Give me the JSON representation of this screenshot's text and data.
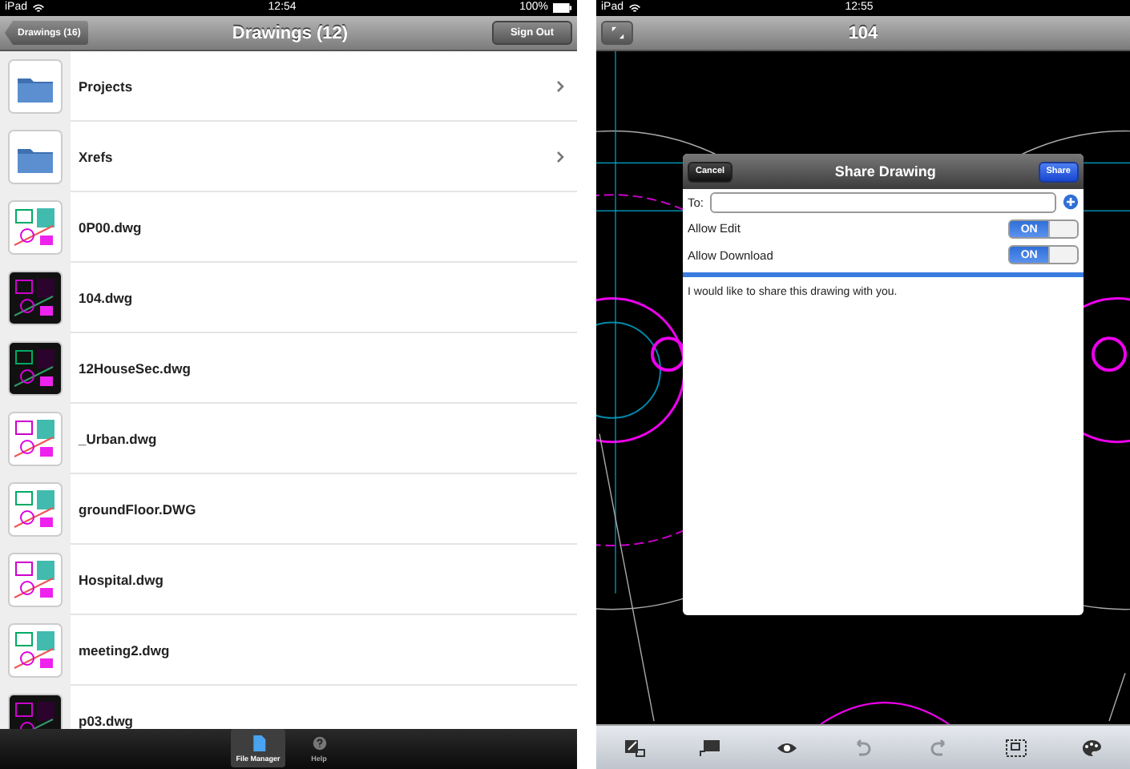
{
  "left": {
    "status_bar": {
      "carrier": "iPad",
      "time": "12:54",
      "battery": "100%"
    },
    "nav": {
      "back": "Drawings (16)",
      "title": "Drawings (12)",
      "action": "Sign Out"
    },
    "items": [
      {
        "kind": "folder",
        "name": "Projects"
      },
      {
        "kind": "folder",
        "name": "Xrefs"
      },
      {
        "kind": "file",
        "name": "0P00.dwg"
      },
      {
        "kind": "file",
        "name": "104.dwg"
      },
      {
        "kind": "file",
        "name": "12HouseSec.dwg"
      },
      {
        "kind": "file",
        "name": "_Urban.dwg"
      },
      {
        "kind": "file",
        "name": "groundFloor.DWG"
      },
      {
        "kind": "file",
        "name": "Hospital.dwg"
      },
      {
        "kind": "file",
        "name": "meeting2.dwg"
      },
      {
        "kind": "file",
        "name": "p03.dwg"
      }
    ],
    "tabs": [
      {
        "kind": "file",
        "label": "File Manager",
        "selected": true
      },
      {
        "kind": "help",
        "label": "Help",
        "selected": false
      }
    ]
  },
  "right": {
    "status_bar": {
      "carrier": "iPad",
      "time": "12:55"
    },
    "nav": {
      "title": "104"
    },
    "dialog": {
      "title": "Share Drawing",
      "cancel": "Cancel",
      "share": "Share",
      "to_label": "To:",
      "toggles": [
        {
          "label": "Allow Edit",
          "on": true,
          "text": "ON"
        },
        {
          "label": "Allow Download",
          "on": true,
          "text": "ON"
        }
      ],
      "message": "I would like to share this drawing with you."
    },
    "toolbar": [
      {
        "kind": "markup",
        "disabled": false
      },
      {
        "kind": "comment",
        "disabled": false
      },
      {
        "kind": "eye",
        "disabled": false
      },
      {
        "kind": "undo",
        "disabled": true
      },
      {
        "kind": "redo",
        "disabled": true
      },
      {
        "kind": "select",
        "disabled": false
      },
      {
        "kind": "palette",
        "disabled": false
      }
    ]
  }
}
